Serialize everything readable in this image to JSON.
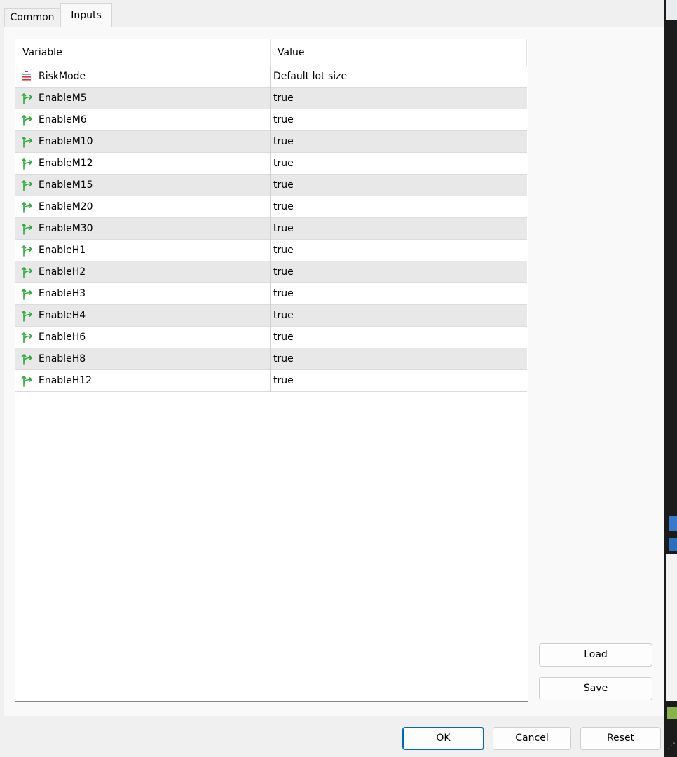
{
  "tabs": [
    {
      "label": "Common",
      "active": false
    },
    {
      "label": "Inputs",
      "active": true
    }
  ],
  "grid": {
    "columns": [
      "Variable",
      "Value"
    ],
    "rows": [
      {
        "name": "RiskMode",
        "value": "Default lot size",
        "icon": "enum-icon"
      },
      {
        "name": "EnableM5",
        "value": "true",
        "icon": "bool-icon"
      },
      {
        "name": "EnableM6",
        "value": "true",
        "icon": "bool-icon"
      },
      {
        "name": "EnableM10",
        "value": "true",
        "icon": "bool-icon"
      },
      {
        "name": "EnableM12",
        "value": "true",
        "icon": "bool-icon"
      },
      {
        "name": "EnableM15",
        "value": "true",
        "icon": "bool-icon"
      },
      {
        "name": "EnableM20",
        "value": "true",
        "icon": "bool-icon"
      },
      {
        "name": "EnableM30",
        "value": "true",
        "icon": "bool-icon"
      },
      {
        "name": "EnableH1",
        "value": "true",
        "icon": "bool-icon"
      },
      {
        "name": "EnableH2",
        "value": "true",
        "icon": "bool-icon"
      },
      {
        "name": "EnableH3",
        "value": "true",
        "icon": "bool-icon"
      },
      {
        "name": "EnableH4",
        "value": "true",
        "icon": "bool-icon"
      },
      {
        "name": "EnableH6",
        "value": "true",
        "icon": "bool-icon"
      },
      {
        "name": "EnableH8",
        "value": "true",
        "icon": "bool-icon"
      },
      {
        "name": "EnableH12",
        "value": "true",
        "icon": "bool-icon"
      }
    ]
  },
  "side_buttons": {
    "load": "Load",
    "save": "Save"
  },
  "footer_buttons": {
    "ok": "OK",
    "cancel": "Cancel",
    "reset": "Reset"
  },
  "colors": {
    "bool_icon": "#2eab3c",
    "enum_icon_red": "#d9363e",
    "enum_icon_blue": "#2f6fd6",
    "primary_border": "#0067c0",
    "alt_row": "#e8e8e8"
  }
}
